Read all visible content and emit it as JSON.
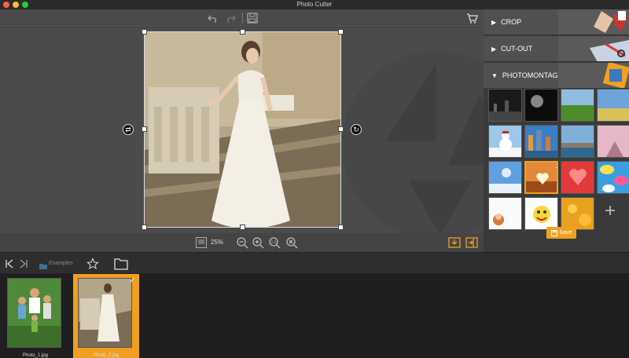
{
  "app": {
    "title": "Photo Cutter"
  },
  "canvas": {
    "zoom": "25%"
  },
  "panel": {
    "sections": [
      {
        "label": "CROP",
        "expanded": false
      },
      {
        "label": "CUT-OUT",
        "expanded": false
      },
      {
        "label": "PHOTOMONTAGE",
        "expanded": true
      }
    ],
    "backgrounds": [
      {
        "name": "dark-city"
      },
      {
        "name": "stage-light"
      },
      {
        "name": "green-field"
      },
      {
        "name": "sky-field"
      },
      {
        "name": "snowman"
      },
      {
        "name": "city-river"
      },
      {
        "name": "harbor"
      },
      {
        "name": "pink-trees"
      },
      {
        "name": "winter-sky"
      },
      {
        "name": "heart-sunset",
        "selected": true
      },
      {
        "name": "red-hearts"
      },
      {
        "name": "comic-bubbles"
      },
      {
        "name": "cartoon-character"
      },
      {
        "name": "cartoon-face"
      },
      {
        "name": "golden-bokeh"
      }
    ],
    "save_label": "Save"
  },
  "browser": {
    "folder_label": "Examples",
    "files": [
      {
        "name": "Photo_1.jpg",
        "selected": false
      },
      {
        "name": "Photo_2.jpg",
        "selected": true
      }
    ]
  },
  "colors": {
    "accent": "#f0a020",
    "panel": "#3a3a3a",
    "canvas": "#4b4b4b"
  }
}
